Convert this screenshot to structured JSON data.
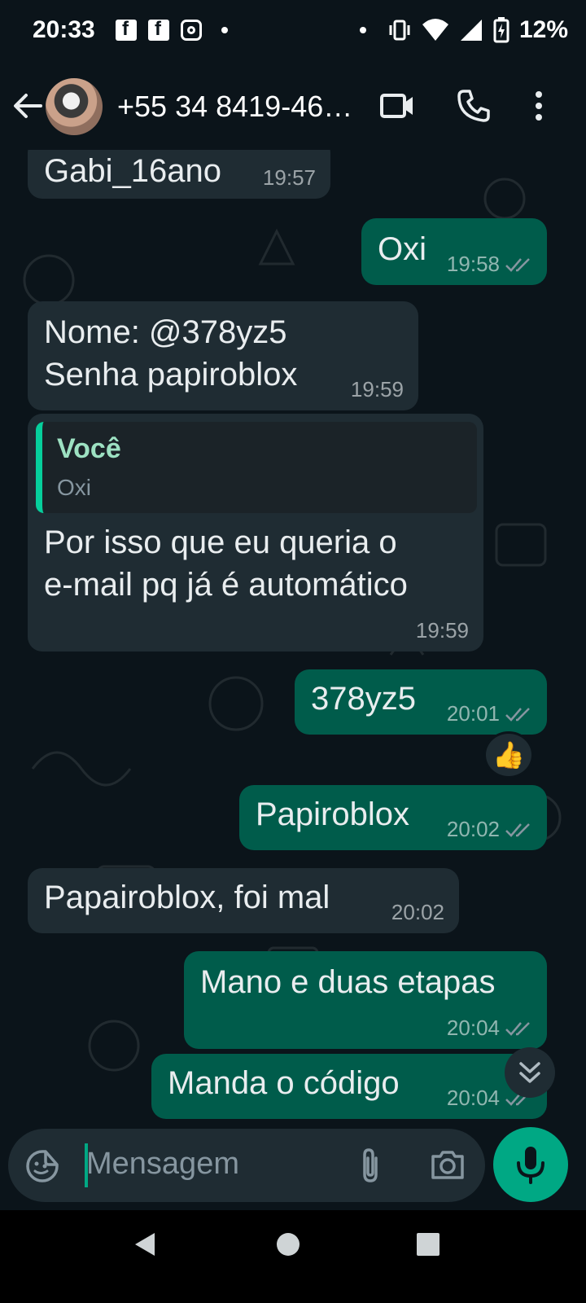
{
  "status_bar": {
    "time": "20:33",
    "battery_percent": "12%",
    "icons": [
      "facebook-icon",
      "facebook-icon",
      "instagram-icon",
      "notification-dot",
      "vibrate-icon",
      "wifi-icon",
      "signal-icon",
      "battery-charging-icon"
    ]
  },
  "header": {
    "contact_name": "+55 34 8419-46…",
    "icons": [
      "back-arrow-icon",
      "video-call-icon",
      "phone-call-icon",
      "more-options-icon"
    ]
  },
  "messages": [
    {
      "direction": "in",
      "text": "Gabi_16ano",
      "time": "19:57"
    },
    {
      "direction": "out",
      "text": "Oxi",
      "time": "19:58",
      "status": "read"
    },
    {
      "direction": "in",
      "lines": [
        "Nome: @378yz5",
        "Senha papiroblox"
      ],
      "time": "19:59"
    },
    {
      "direction": "in",
      "quote": {
        "author": "Você",
        "text": "Oxi"
      },
      "lines": [
        "Por isso que eu queria o",
        "e-mail pq já é automático"
      ],
      "time": "19:59"
    },
    {
      "direction": "out",
      "text": "378yz5",
      "time": "20:01",
      "status": "read",
      "reaction": "👍"
    },
    {
      "direction": "out",
      "text": "Papiroblox",
      "time": "20:02",
      "status": "read"
    },
    {
      "direction": "in",
      "text": "Papairoblox, foi mal",
      "time": "20:02"
    },
    {
      "direction": "out",
      "text": "Mano e duas etapas",
      "time": "20:04",
      "status": "read"
    },
    {
      "direction": "out",
      "text": "Manda o código",
      "time": "20:04",
      "status": "read"
    }
  ],
  "composer": {
    "placeholder": "Mensagem",
    "icons": [
      "sticker-icon",
      "attach-icon",
      "camera-icon",
      "mic-icon"
    ]
  },
  "colors": {
    "background": "#0b141a",
    "incoming_bubble": "#1f2c33",
    "outgoing_bubble": "#005c4b",
    "accent": "#00a884"
  },
  "nav": {
    "icons": [
      "nav-back-icon",
      "nav-home-icon",
      "nav-recents-icon"
    ]
  }
}
